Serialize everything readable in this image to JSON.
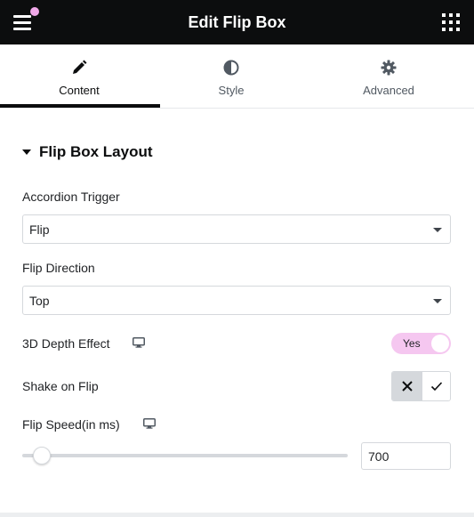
{
  "header": {
    "title": "Edit Flip Box",
    "menu_icon": "hamburger-icon",
    "apps_icon": "grid-icon",
    "notification_dot_color": "#f0a8e8"
  },
  "tabs": [
    {
      "label": "Content",
      "icon": "pencil-icon",
      "active": true
    },
    {
      "label": "Style",
      "icon": "half-circle-icon",
      "active": false
    },
    {
      "label": "Advanced",
      "icon": "gear-icon",
      "active": false
    }
  ],
  "section": {
    "title": "Flip Box Layout",
    "expanded": true
  },
  "controls": {
    "accordion_trigger": {
      "label": "Accordion Trigger",
      "value": "Flip"
    },
    "flip_direction": {
      "label": "Flip Direction",
      "value": "Top"
    },
    "depth_effect": {
      "label": "3D Depth Effect",
      "toggle_text": "Yes",
      "on": true,
      "responsive_icon": "monitor-icon"
    },
    "shake_on_flip": {
      "label": "Shake on Flip",
      "options": [
        "no",
        "yes"
      ],
      "selected": "no"
    },
    "flip_speed": {
      "label": "Flip Speed(in ms)",
      "value": "700",
      "responsive_icon": "monitor-icon"
    }
  },
  "colors": {
    "header_bg": "#0c0d0e",
    "accent_pink": "#f5c7f0",
    "border": "#d5d8dc"
  }
}
